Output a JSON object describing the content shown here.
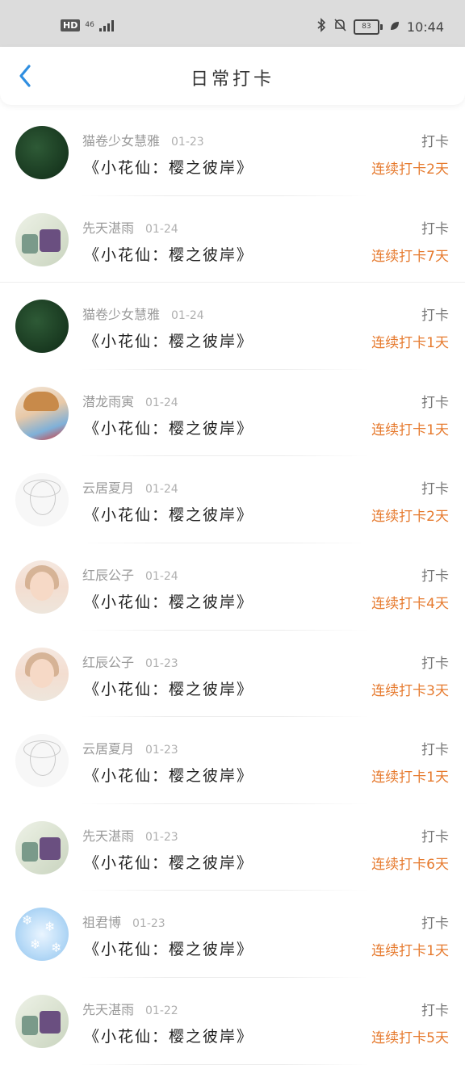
{
  "status_bar": {
    "hd": "HD",
    "network": "46",
    "battery": "83",
    "time": "10:44"
  },
  "header": {
    "title": "日常打卡"
  },
  "colors": {
    "accent": "#e67a2e",
    "back_arrow": "#2f8ee0"
  },
  "items": [
    {
      "author": "猫卷少女慧雅",
      "date": "01-23",
      "book": "《小花仙：樱之彼岸》",
      "action": "打卡",
      "streak": "连续打卡2天",
      "avatar": "dark-forest-avatar"
    },
    {
      "author": "先天湛雨",
      "date": "01-24",
      "book": "《小花仙：樱之彼岸》",
      "action": "打卡",
      "streak": "连续打卡7天",
      "avatar": "bags-avatar"
    },
    {
      "author": "猫卷少女慧雅",
      "date": "01-24",
      "book": "《小花仙：樱之彼岸》",
      "action": "打卡",
      "streak": "连续打卡1天",
      "avatar": "dark-forest-avatar"
    },
    {
      "author": "潜龙雨寅",
      "date": "01-24",
      "book": "《小花仙：樱之彼岸》",
      "action": "打卡",
      "streak": "连续打卡1天",
      "avatar": "boy-avatar"
    },
    {
      "author": "云居夏月",
      "date": "01-24",
      "book": "《小花仙：樱之彼岸》",
      "action": "打卡",
      "streak": "连续打卡2天",
      "avatar": "sketch-avatar"
    },
    {
      "author": "红辰公子",
      "date": "01-24",
      "book": "《小花仙：樱之彼岸》",
      "action": "打卡",
      "streak": "连续打卡4天",
      "avatar": "girl-avatar"
    },
    {
      "author": "红辰公子",
      "date": "01-23",
      "book": "《小花仙：樱之彼岸》",
      "action": "打卡",
      "streak": "连续打卡3天",
      "avatar": "girl-avatar"
    },
    {
      "author": "云居夏月",
      "date": "01-23",
      "book": "《小花仙：樱之彼岸》",
      "action": "打卡",
      "streak": "连续打卡1天",
      "avatar": "sketch-avatar"
    },
    {
      "author": "先天湛雨",
      "date": "01-23",
      "book": "《小花仙：樱之彼岸》",
      "action": "打卡",
      "streak": "连续打卡6天",
      "avatar": "bags-avatar"
    },
    {
      "author": "祖君博",
      "date": "01-23",
      "book": "《小花仙：樱之彼岸》",
      "action": "打卡",
      "streak": "连续打卡1天",
      "avatar": "snowflake-avatar"
    },
    {
      "author": "先天湛雨",
      "date": "01-22",
      "book": "《小花仙：樱之彼岸》",
      "action": "打卡",
      "streak": "连续打卡5天",
      "avatar": "bags-avatar"
    }
  ]
}
